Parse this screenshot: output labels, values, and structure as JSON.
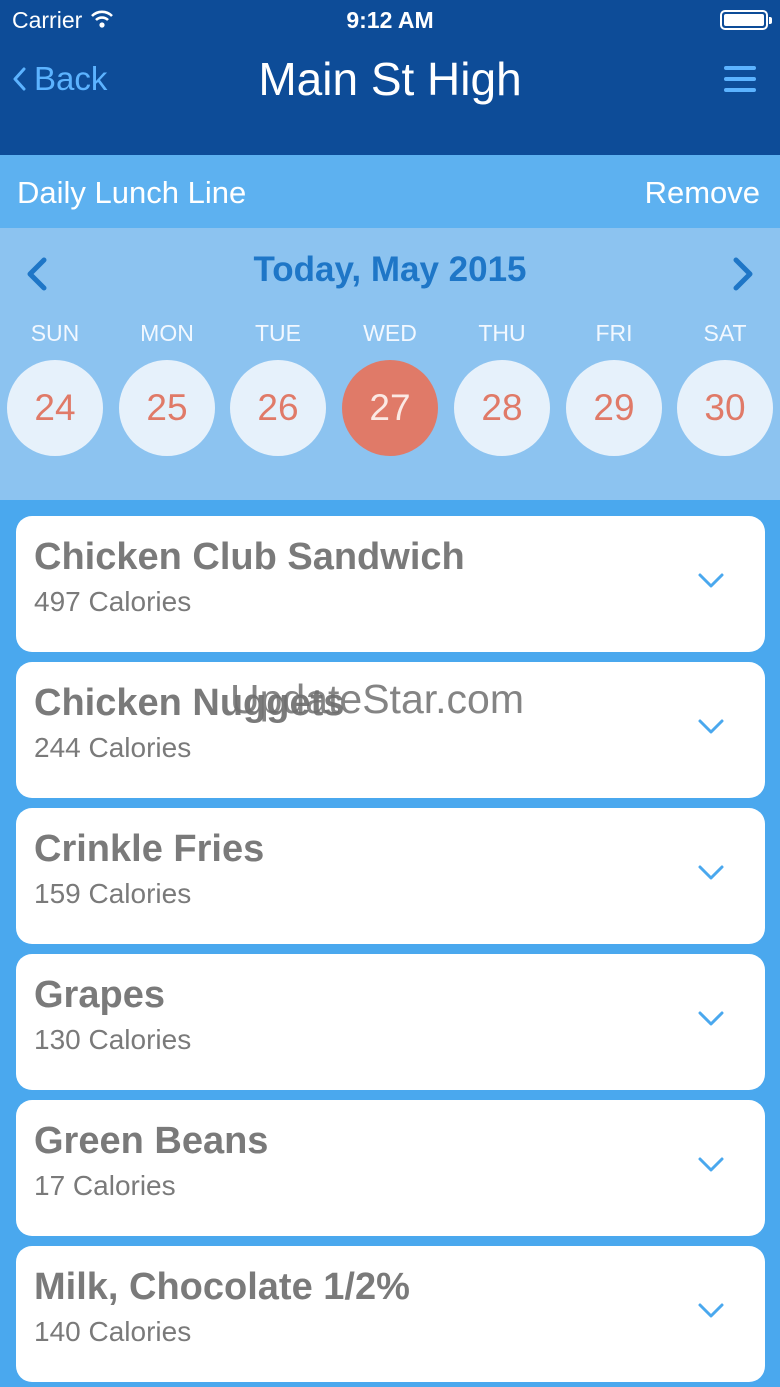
{
  "status_bar": {
    "carrier": "Carrier",
    "time": "9:12 AM"
  },
  "nav": {
    "back_label": "Back",
    "title": "Main St High"
  },
  "sub_header": {
    "title": "Daily Lunch Line",
    "action": "Remove"
  },
  "calendar": {
    "month_label": "Today, May 2015",
    "weekdays": [
      "SUN",
      "MON",
      "TUE",
      "WED",
      "THU",
      "FRI",
      "SAT"
    ],
    "days": [
      "24",
      "25",
      "26",
      "27",
      "28",
      "29",
      "30"
    ],
    "selected_day": "27"
  },
  "menu_items": [
    {
      "name": "Chicken Club Sandwich",
      "calories": "497 Calories"
    },
    {
      "name": "Chicken Nuggets",
      "calories": "244 Calories"
    },
    {
      "name": "Crinkle Fries",
      "calories": "159 Calories"
    },
    {
      "name": "Grapes",
      "calories": "130 Calories"
    },
    {
      "name": "Green Beans",
      "calories": "17 Calories"
    },
    {
      "name": "Milk, Chocolate 1/2%",
      "calories": "140 Calories"
    }
  ],
  "watermark": "UpdateStar.com",
  "colors": {
    "nav_bg": "#0d4c98",
    "accent": "#5cb3ff",
    "selected_day": "#e07a68",
    "page_bg": "#4aa8ee"
  },
  "icons": {
    "wifi": "wifi-icon",
    "battery": "battery-icon",
    "back": "chevron-left-icon",
    "menu": "hamburger-menu-icon",
    "prev": "chevron-left-icon",
    "next": "chevron-right-icon",
    "expand": "chevron-down-icon"
  }
}
